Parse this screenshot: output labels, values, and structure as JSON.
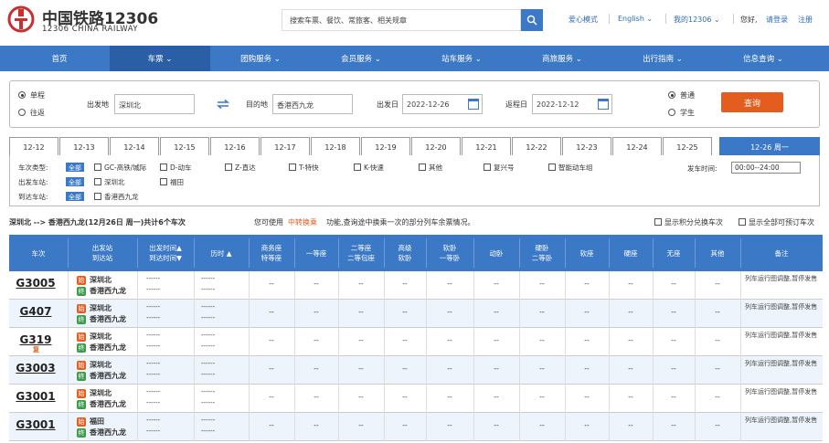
{
  "header": {
    "logo_cn": "中国铁路12306",
    "logo_en": "12306 CHINA RAILWAY",
    "search_placeholder": "搜索车票、餐饮、常旅客、相关规章",
    "links": [
      "爱心模式",
      "English ⌄",
      "我的12306 ⌄",
      "您好,",
      "请登录",
      "注册"
    ]
  },
  "nav": [
    "首页",
    "车票 ⌄",
    "团购服务 ⌄",
    "会员服务 ⌄",
    "站车服务 ⌄",
    "商旅服务 ⌄",
    "出行指南 ⌄",
    "信息查询 ⌄"
  ],
  "query": {
    "trip_types": [
      "单程",
      "往返"
    ],
    "from_label": "出发地",
    "from_value": "深圳北",
    "to_label": "目的地",
    "to_value": "香港西九龙",
    "depart_label": "出发日",
    "depart_value": "2022-12-26",
    "return_label": "返程日",
    "return_value": "2022-12-12",
    "passenger_types": [
      "普通",
      "学生"
    ],
    "search_button": "查询"
  },
  "date_tabs": [
    "12-12",
    "12-13",
    "12-14",
    "12-15",
    "12-16",
    "12-17",
    "12-18",
    "12-19",
    "12-20",
    "12-21",
    "12-22",
    "12-23",
    "12-24",
    "12-25",
    "12-26 周一"
  ],
  "filters": {
    "type_label": "车次类型:",
    "depart_station_label": "出发车站:",
    "arrive_station_label": "到达车站:",
    "all_tag": "全部",
    "types": [
      "GC-高铁/城际",
      "D-动车",
      "Z-直达",
      "T-特快",
      "K-快速",
      "其他",
      "复兴号",
      "智能动车组"
    ],
    "depart_stations": [
      "深圳北",
      "福田"
    ],
    "arrive_stations": [
      "香港西九龙"
    ],
    "time_label": "发车时间:",
    "time_value": "00:00--24:00"
  },
  "info": {
    "route": "深圳北 --> 香港西九龙(12月26日 周一)共计6个车次",
    "tip_prefix": "您可使用",
    "tip_link": "中转换乘",
    "tip_suffix": "功能,查询途中换乘一次的部分列车余票情况。",
    "check1": "显示积分兑换车次",
    "check2": "显示全部可预订车次"
  },
  "table": {
    "headers": [
      [
        "车次"
      ],
      [
        "出发站",
        "到达站"
      ],
      [
        "出发时间▲",
        "到达时间▼"
      ],
      [
        "历时 ▲"
      ],
      [
        "商务座",
        "特等座"
      ],
      [
        "一等座"
      ],
      [
        "二等座",
        "二等包座"
      ],
      [
        "高级",
        "软卧"
      ],
      [
        "软卧",
        "一等卧"
      ],
      [
        "动卧"
      ],
      [
        "硬卧",
        "二等卧"
      ],
      [
        "软座"
      ],
      [
        "硬座"
      ],
      [
        "无座"
      ],
      [
        "其他"
      ],
      [
        "备注"
      ]
    ],
    "rows": [
      {
        "train": "G3005",
        "from": "深圳北",
        "to": "香港西九龙",
        "note": "列车运行图调整,暂停发售",
        "fu": false
      },
      {
        "train": "G407",
        "from": "深圳北",
        "to": "香港西九龙",
        "note": "列车运行图调整,暂停发售",
        "fu": false
      },
      {
        "train": "G319",
        "from": "深圳北",
        "to": "香港西九龙",
        "note": "列车运行图调整,暂停发售",
        "fu": true
      },
      {
        "train": "G3003",
        "from": "深圳北",
        "to": "香港西九龙",
        "note": "列车运行图调整,暂停发售",
        "fu": false
      },
      {
        "train": "G3001",
        "from": "深圳北",
        "to": "香港西九龙",
        "note": "列车运行图调整,暂停发售",
        "fu": false
      },
      {
        "train": "G3001",
        "from": "福田",
        "to": "香港西九龙",
        "note": "列车运行图调整,暂停发售",
        "fu": false
      }
    ],
    "dash_time": "------",
    "dash_cell": "--",
    "fu_badge": "复",
    "start_badge": "始",
    "end_badge": "终"
  },
  "colors": {
    "brand": "#3b78c5",
    "accent": "#e35d1f",
    "logo": "#c8302f"
  }
}
